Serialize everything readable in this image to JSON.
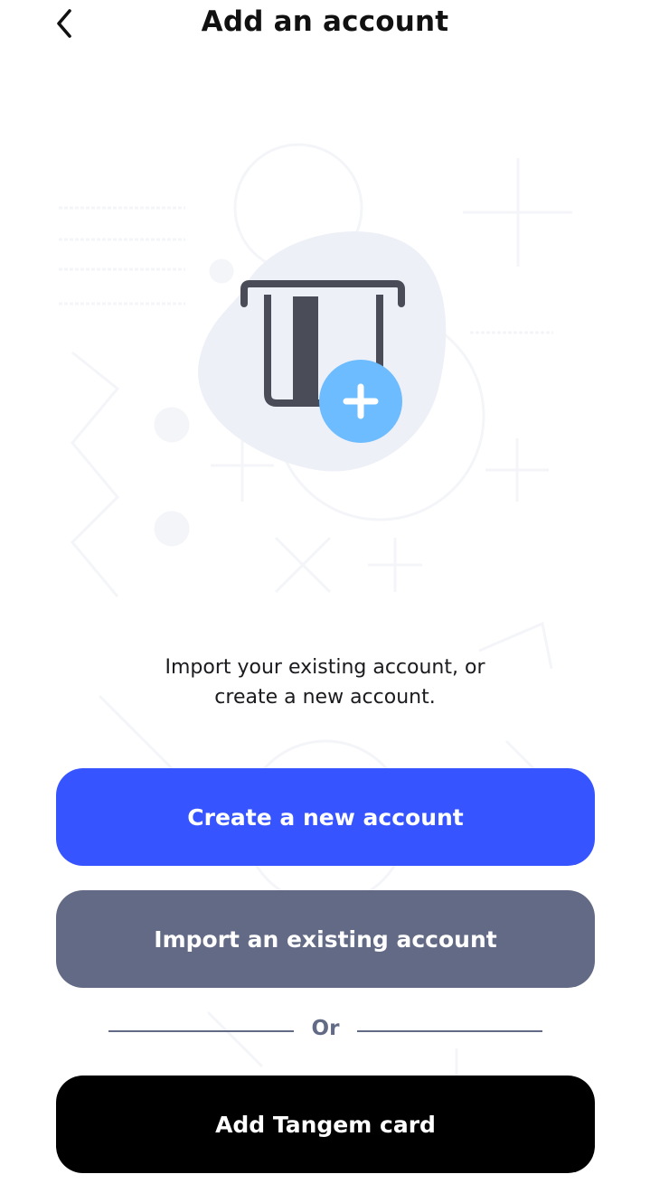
{
  "header": {
    "title": "Add an account",
    "back_icon": "chevron-left-icon"
  },
  "illustration": {
    "icon": "card-slot-plus-icon",
    "accent_color": "#6cbcff",
    "card_color": "#4a4d57",
    "blob_color": "#eef0f8"
  },
  "description": {
    "line1": "Import your existing account, or",
    "line2": "create a new account."
  },
  "buttons": {
    "create_label": "Create a new account",
    "import_label": "Import an existing account",
    "card_label": "Add Tangem card"
  },
  "divider": {
    "label": "Or"
  },
  "colors": {
    "primary": "#3654ff",
    "secondary": "#626a85",
    "dark": "#000000"
  }
}
